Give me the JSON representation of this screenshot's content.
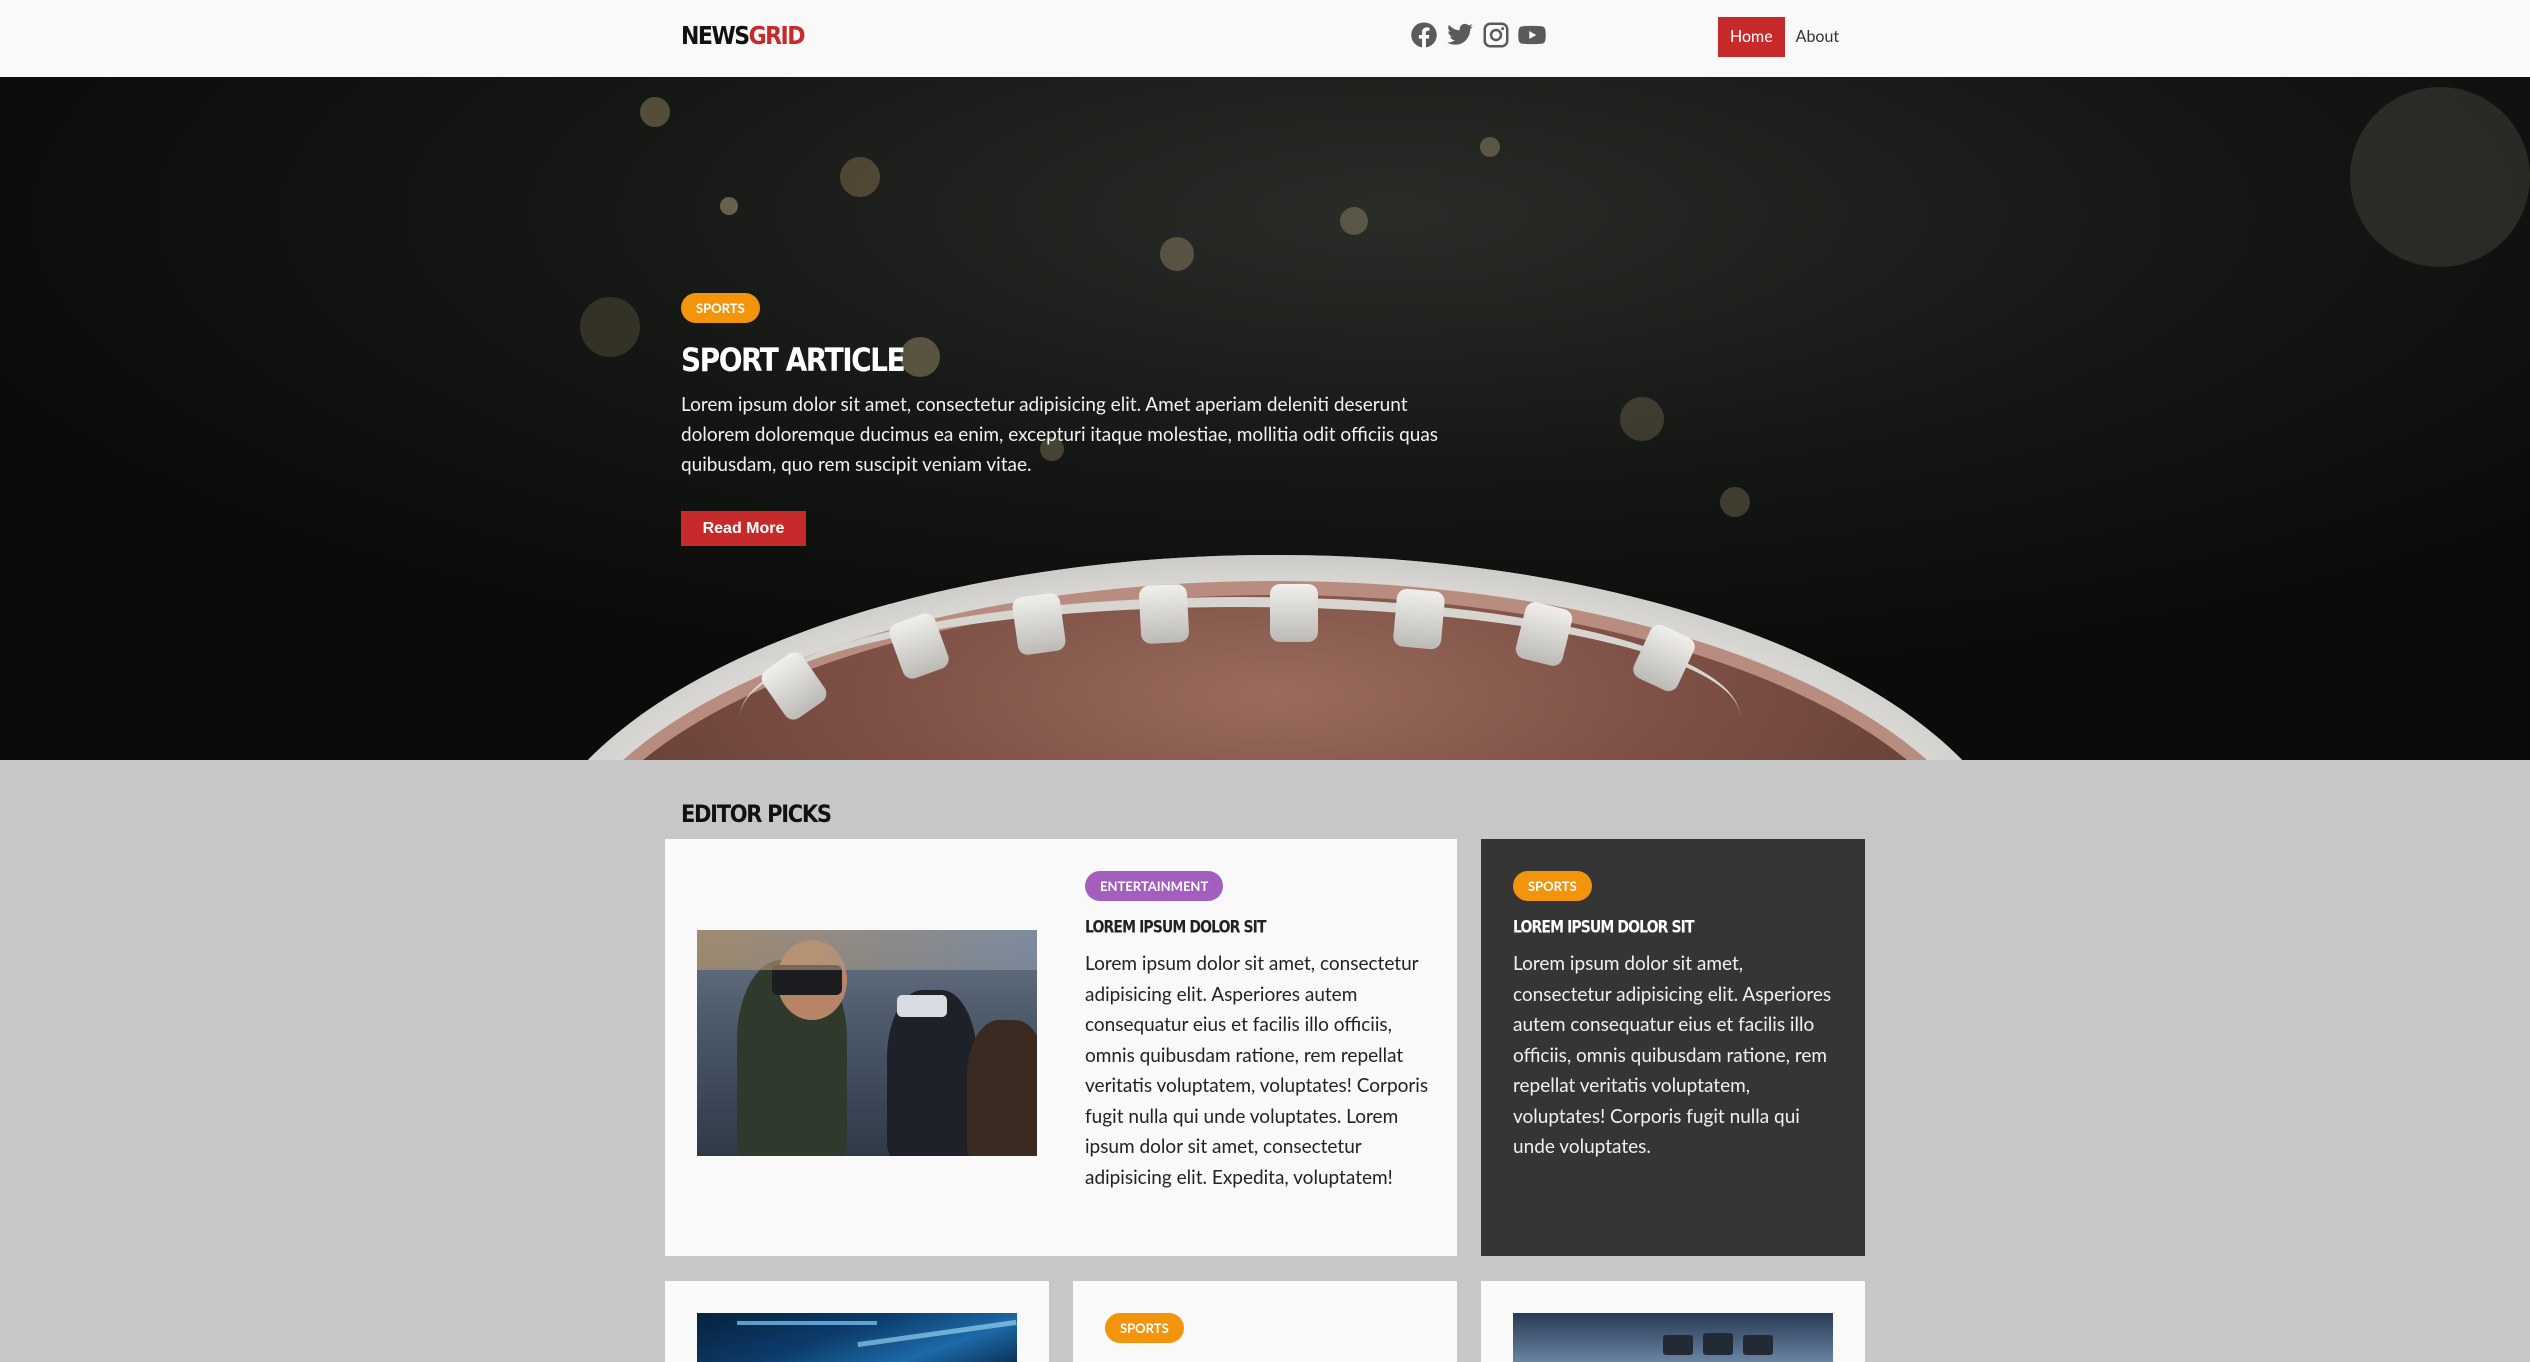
{
  "nav": {
    "logo_part1": "NEWS",
    "logo_part2": "GRID",
    "social_icons": [
      "facebook-icon",
      "twitter-icon",
      "instagram-icon",
      "youtube-icon"
    ],
    "links": [
      {
        "label": "Home",
        "active": true
      },
      {
        "label": "About",
        "active": false
      }
    ]
  },
  "hero": {
    "category": "SPORTS",
    "title": "SPORT ARTICLE",
    "text": "Lorem ipsum dolor sit amet, consectetur adipisicing elit. Amet aperiam deleniti deserunt dolorem doloremque ducimus ea enim, excepturi itaque molestiae, mollitia odit officiis quas quibusdam, quo rem suscipit veniam vitae.",
    "button": "Read More"
  },
  "editor_picks": {
    "heading": "EDITOR PICKS",
    "featured": {
      "category": "ENTERTAINMENT",
      "title": "LOREM IPSUM DOLOR SIT",
      "text": "Lorem ipsum dolor sit amet, consectetur adipisicing elit. Asperiores autem consequatur eius et facilis illo officiis, omnis quibusdam ratione, rem repellat veritatis voluptatem, voluptates! Corporis fugit nulla qui unde voluptates. Lorem ipsum dolor sit amet, consectetur adipisicing elit. Expedita, voluptatem!"
    },
    "side": {
      "category": "SPORTS",
      "title": "LOREM IPSUM DOLOR SIT",
      "text": "Lorem ipsum dolor sit amet, consectetur adipisicing elit. Asperiores autem consequatur eius et facilis illo officiis, omnis quibusdam ratione, rem repellat veritatis voluptatem, voluptates! Corporis fugit nulla qui unde voluptates."
    },
    "row2_middle_category": "SPORTS"
  },
  "colors": {
    "accent_red": "#c62a2a",
    "sports_orange": "#f2950c",
    "entertainment_purple": "#a45ebd",
    "dark_card": "#353535"
  }
}
